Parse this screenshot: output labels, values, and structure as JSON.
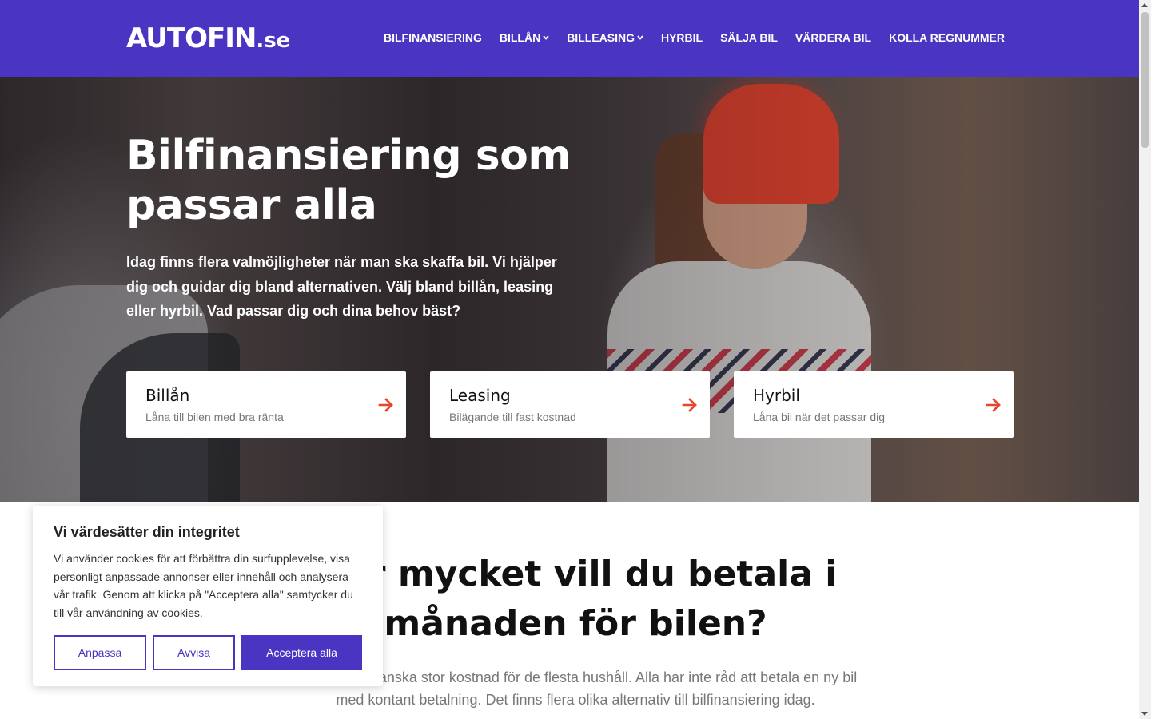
{
  "header": {
    "logo_main": "AUTOFIN",
    "logo_tld": ".se",
    "nav": [
      {
        "label": "BILFINANSIERING",
        "dropdown": false
      },
      {
        "label": "BILLÅN",
        "dropdown": true
      },
      {
        "label": "BILLEASING",
        "dropdown": true
      },
      {
        "label": "HYRBIL",
        "dropdown": false
      },
      {
        "label": "SÄLJA BIL",
        "dropdown": false
      },
      {
        "label": "VÄRDERA BIL",
        "dropdown": false
      },
      {
        "label": "KOLLA REGNUMMER",
        "dropdown": false
      }
    ]
  },
  "hero": {
    "title": "Bilfinansiering som passar alla",
    "text": "Idag finns flera valmöjligheter när man ska skaffa bil. Vi hjälper dig och guidar dig bland alternativen. Välj bland billån, leasing eller hyrbil. Vad passar dig och dina behov bäst?",
    "cards": [
      {
        "title": "Billån",
        "subtitle": "Låna till bilen med bra ränta",
        "icon": "arrow-right-icon"
      },
      {
        "title": "Leasing",
        "subtitle": "Bilägande till fast kostnad",
        "icon": "arrow-right-icon"
      },
      {
        "title": "Hyrbil",
        "subtitle": "Låna bil när det passar dig",
        "icon": "arrow-right-icon"
      }
    ]
  },
  "section": {
    "title": "Hur mycket vill du betala i månaden för bilen?",
    "text": "En bil är en ganska stor kostnad för de flesta hushåll. Alla har inte råd att betala en ny bil med kontant betalning. Det finns flera olika alternativ till bilfinansiering idag."
  },
  "cookie": {
    "title": "Vi värdesätter din integritet",
    "text": "Vi använder cookies för att förbättra din surfupplevelse, visa personligt anpassade annonser eller innehåll och analysera vår trafik. Genom att klicka på \"Acceptera alla\" samtycker du till vår användning av cookies.",
    "customize_label": "Anpassa",
    "reject_label": "Avvisa",
    "accept_label": "Acceptera alla"
  },
  "colors": {
    "brand": "#4a34c2",
    "accent_arrow": "#e8432d"
  }
}
